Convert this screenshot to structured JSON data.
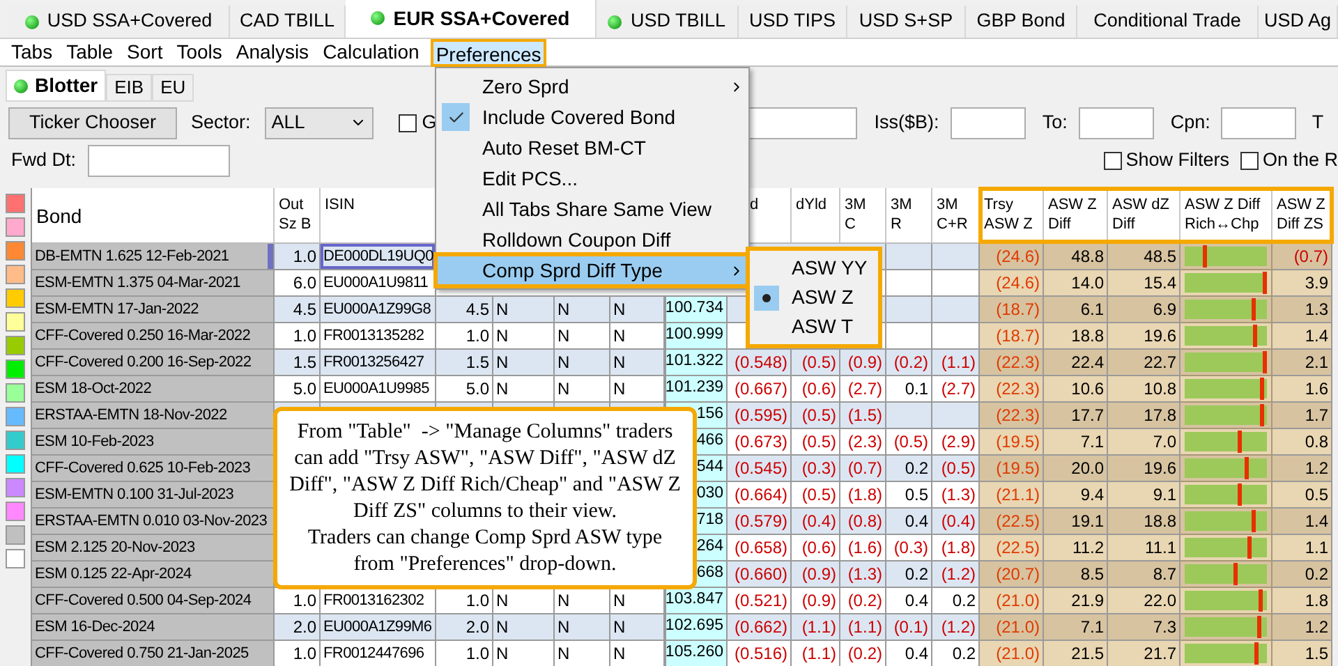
{
  "tabs": [
    {
      "label": "USD SSA+Covered",
      "dot": true,
      "selected": false
    },
    {
      "label": "CAD TBILL",
      "dot": false,
      "selected": false
    },
    {
      "label": "EUR SSA+Covered",
      "dot": true,
      "selected": true
    },
    {
      "label": "USD TBILL",
      "dot": true,
      "selected": false
    },
    {
      "label": "USD TIPS",
      "dot": false,
      "selected": false
    },
    {
      "label": "USD S+SP",
      "dot": false,
      "selected": false
    },
    {
      "label": "GBP Bond",
      "dot": false,
      "selected": false
    },
    {
      "label": "Conditional Trade",
      "dot": false,
      "selected": false
    },
    {
      "label": "USD Ag",
      "dot": false,
      "selected": false
    }
  ],
  "menu_bar": [
    {
      "label": "Tabs",
      "selected": false
    },
    {
      "label": "Table",
      "selected": false
    },
    {
      "label": "Sort",
      "selected": false
    },
    {
      "label": "Tools",
      "selected": false
    },
    {
      "label": "Analysis",
      "selected": false
    },
    {
      "label": "Calculation",
      "selected": false
    },
    {
      "label": "Preferences",
      "selected": true
    }
  ],
  "sub_tabs": [
    {
      "label": "Blotter",
      "dot": true,
      "selected": true
    },
    {
      "label": "EIB",
      "dot": false,
      "selected": false
    },
    {
      "label": "EU",
      "dot": false,
      "selected": false
    }
  ],
  "toolbar": {
    "ticker_button": "Ticker Chooser",
    "sector_label": "Sector:",
    "sector_value": "ALL",
    "checkbox": {
      "label": "G",
      "checked": false
    },
    "iss_label": "Iss($B):",
    "to_label": "To:",
    "cpn_label": "Cpn:",
    "cut_label": "T",
    "fwd_label": "Fwd Dt:",
    "show_filters": {
      "label": "Show Filters",
      "checked": false
    },
    "on_the_r": {
      "label": "On the R",
      "checked": false
    }
  },
  "preferences_menu": [
    {
      "label": "Zero Sprd",
      "checked": false,
      "submenu": true,
      "selected": false
    },
    {
      "label": "Include Covered Bond",
      "checked": true,
      "submenu": false,
      "selected": false
    },
    {
      "label": "Auto Reset BM-CT",
      "checked": false,
      "submenu": false,
      "selected": false
    },
    {
      "label": "Edit PCS...",
      "checked": false,
      "submenu": false,
      "selected": false
    },
    {
      "label": "All Tabs Share Same View",
      "checked": false,
      "submenu": false,
      "selected": false
    },
    {
      "label": "Rolldown Coupon Diff",
      "checked": false,
      "submenu": false,
      "selected": false
    },
    {
      "label": "Comp Sprd Diff Type",
      "checked": false,
      "submenu": true,
      "selected": true
    }
  ],
  "submenu": [
    {
      "label": "ASW YY",
      "selected": false
    },
    {
      "label": "ASW Z",
      "selected": true
    },
    {
      "label": "ASW T",
      "selected": false
    }
  ],
  "palette": [
    {
      "color": "#ff7070"
    },
    {
      "color": "#ffaacc"
    },
    {
      "color": "#ff8833"
    },
    {
      "color": "#ffbb88"
    },
    {
      "color": "#ffcc00"
    },
    {
      "color": "#ffff99"
    },
    {
      "color": "#99cc00"
    },
    {
      "color": "#00ee00"
    },
    {
      "color": "#99ff99"
    },
    {
      "color": "#66bbff"
    },
    {
      "color": "#33cccc"
    },
    {
      "color": "#00ffff"
    },
    {
      "color": "#cc88ff"
    },
    {
      "color": "#ff88ff"
    },
    {
      "color": "#c0c0c0"
    },
    {
      "color": "#ffffff"
    }
  ],
  "table": {
    "columns": [
      {
        "label": "Bond",
        "highlighted": false
      },
      {
        "label": "Out\nSz B",
        "highlighted": false
      },
      {
        "label": "ISIN",
        "highlighted": false
      },
      {},
      {},
      {},
      {},
      {},
      {
        "label": "d",
        "kind": "cut",
        "highlighted": false
      },
      {
        "label": "dYld",
        "highlighted": false
      },
      {
        "label": "3M\nC",
        "highlighted": false
      },
      {
        "label": "3M\nR",
        "highlighted": false
      },
      {
        "label": "3M\nC+R",
        "highlighted": false
      },
      {
        "label": "Trsy\nASW Z",
        "highlighted": true
      },
      {
        "label": "ASW Z\nDiff",
        "highlighted": true
      },
      {
        "label": "ASW dZ\nDiff",
        "highlighted": true
      },
      {
        "label": "ASW Z Diff\nRich↔Chp",
        "highlighted": true
      },
      {
        "label": "ASW Z\nDiff ZS",
        "highlighted": true
      }
    ],
    "rows": [
      {
        "selected": true,
        "level": 0.23,
        "cells": [
          "DB-EMTN 1.625 12-Feb-2021",
          "1.0",
          "DE000DL19UQ0",
          null,
          null,
          null,
          null,
          null,
          null,
          null,
          null,
          null,
          null,
          "(24.6)",
          "48.8",
          "48.5",
          "(0.7)"
        ]
      },
      {
        "selected": false,
        "level": 1.0,
        "cells": [
          "ESM-EMTN 1.375 04-Mar-2021",
          "6.0",
          "EU000A1U9811",
          null,
          null,
          null,
          null,
          null,
          null,
          null,
          null,
          null,
          null,
          "(24.6)",
          "14.0",
          "15.4",
          "3.9"
        ]
      },
      {
        "selected": false,
        "level": 0.85,
        "cells": [
          "ESM-EMTN 17-Jan-2022",
          "4.5",
          "EU000A1Z99G8",
          "4.5",
          "N",
          "N",
          "N",
          "100.734",
          null,
          null,
          null,
          null,
          null,
          "(18.7)",
          "6.1",
          "6.9",
          "1.3"
        ]
      },
      {
        "selected": false,
        "level": 0.87,
        "cells": [
          "CFF-Covered 0.250 16-Mar-2022",
          "1.0",
          "FR0013135282",
          "1.0",
          "N",
          "N",
          "N",
          "100.999",
          null,
          null,
          null,
          null,
          null,
          "(18.7)",
          "18.8",
          "19.6",
          "1.4"
        ]
      },
      {
        "selected": false,
        "level": 1.0,
        "cells": [
          "CFF-Covered 0.200 16-Sep-2022",
          "1.5",
          "FR0013256427",
          "1.5",
          "N",
          "N",
          "N",
          "101.322",
          "(0.548)",
          "(0.5)",
          "(0.9)",
          "(0.2)",
          "(1.1)",
          "(22.3)",
          "22.4",
          "22.7",
          "2.1"
        ]
      },
      {
        "selected": false,
        "level": 0.96,
        "cells": [
          "ESM 18-Oct-2022",
          "5.0",
          "EU000A1U9985",
          "5.0",
          "N",
          "N",
          "N",
          "101.239",
          "(0.667)",
          "(0.6)",
          "(2.7)",
          "0.1",
          "(2.7)",
          "(22.3)",
          "10.6",
          "10.8",
          "1.6"
        ]
      },
      {
        "selected": false,
        "level": 0.96,
        "cells": [
          "ERSTAA-EMTN 18-Nov-2022",
          null,
          null,
          null,
          null,
          null,
          null,
          "156",
          "(0.595)",
          "(0.5)",
          "(1.5)",
          null,
          null,
          "(22.3)",
          "17.7",
          "17.8",
          "1.7"
        ]
      },
      {
        "selected": false,
        "level": 0.68,
        "cells": [
          "ESM 10-Feb-2023",
          null,
          null,
          null,
          null,
          null,
          null,
          "466",
          "(0.673)",
          "(0.5)",
          "(2.3)",
          "(0.5)",
          "(2.9)",
          "(19.5)",
          "7.1",
          "7.0",
          "0.8"
        ]
      },
      {
        "selected": false,
        "level": 0.77,
        "cells": [
          "CFF-Covered 0.625 10-Feb-2023",
          null,
          null,
          null,
          null,
          null,
          null,
          "544",
          "(0.545)",
          "(0.3)",
          "(0.7)",
          "0.2",
          "(0.5)",
          "(19.5)",
          "20.0",
          "19.6",
          "1.2"
        ]
      },
      {
        "selected": false,
        "level": 0.67,
        "cells": [
          "ESM-EMTN 0.100 31-Jul-2023",
          null,
          null,
          null,
          null,
          null,
          null,
          "030",
          "(0.664)",
          "(0.5)",
          "(1.8)",
          "0.5",
          "(1.3)",
          "(21.1)",
          "9.4",
          "9.1",
          "0.5"
        ]
      },
      {
        "selected": false,
        "level": 0.85,
        "cells": [
          "ERSTAA-EMTN 0.010 03-Nov-2023",
          null,
          null,
          null,
          null,
          null,
          null,
          "718",
          "(0.579)",
          "(0.4)",
          "(0.8)",
          "0.4",
          "(0.4)",
          "(22.5)",
          "19.1",
          "18.8",
          "1.4"
        ]
      },
      {
        "selected": false,
        "level": 0.81,
        "cells": [
          "ESM 2.125 20-Nov-2023",
          null,
          null,
          null,
          null,
          null,
          null,
          "264",
          "(0.658)",
          "(0.6)",
          "(1.6)",
          "(0.3)",
          "(1.8)",
          "(22.5)",
          "11.2",
          "11.1",
          "1.1"
        ]
      },
      {
        "selected": false,
        "level": 0.63,
        "cells": [
          "ESM 0.125 22-Apr-2024",
          null,
          null,
          null,
          null,
          null,
          null,
          "668",
          "(0.660)",
          "(0.9)",
          "(1.3)",
          "0.2",
          "(1.2)",
          "(20.7)",
          "8.5",
          "8.7",
          "0.2"
        ]
      },
      {
        "selected": false,
        "level": 0.95,
        "cells": [
          "CFF-Covered 0.500 04-Sep-2024",
          "1.0",
          "FR0013162302",
          "1.0",
          "N",
          "N",
          "N",
          "103.847",
          "(0.521)",
          "(0.9)",
          "(0.2)",
          "0.4",
          "0.2",
          "(21.0)",
          "21.9",
          "22.0",
          "1.8"
        ]
      },
      {
        "selected": false,
        "level": 0.92,
        "cells": [
          "ESM 16-Dec-2024",
          "2.0",
          "EU000A1Z99M6",
          "2.0",
          "N",
          "N",
          "N",
          "102.695",
          "(0.662)",
          "(1.1)",
          "(1.1)",
          "(0.1)",
          "(1.2)",
          "(21.0)",
          "7.1",
          "7.3",
          "1.2"
        ]
      },
      {
        "selected": false,
        "level": 0.9,
        "cells": [
          "CFF-Covered 0.750 21-Jan-2025",
          "1.0",
          "FR0012447696",
          "1.0",
          "N",
          "N",
          "N",
          "105.260",
          "(0.516)",
          "(1.1)",
          "(0.2)",
          "0.4",
          "0.2",
          "(21.0)",
          "21.5",
          "21.7",
          "1.5"
        ]
      }
    ]
  },
  "callout": "From \"Table\"  -> \"Manage Columns\" traders can add \"Trsy ASW\", \"ASW Diff\", \"ASW dZ Diff\", \"ASW Z Diff Rich/Cheap\" and \"ASW Z Diff ZS\" columns to their view.\nTraders can change Comp Sprd ASW type from \"Preferences\" drop-down."
}
